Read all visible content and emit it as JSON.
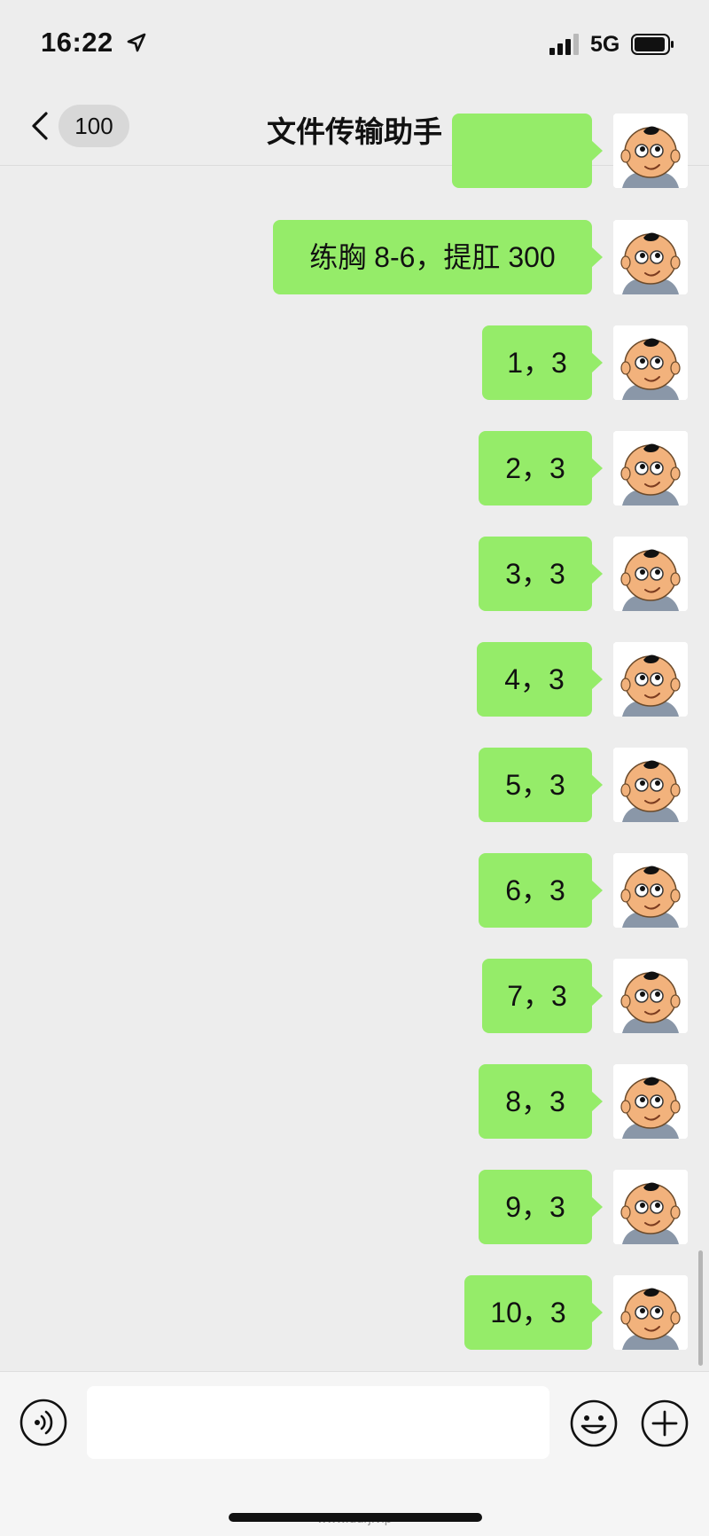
{
  "status_bar": {
    "time": "16:22",
    "network": "5G"
  },
  "nav": {
    "unread_count": "100",
    "title": "文件传输助手"
  },
  "messages": [
    {
      "text": ""
    },
    {
      "text": "练胸 8-6，提肛 300"
    },
    {
      "text": "1，3"
    },
    {
      "text": "2，3"
    },
    {
      "text": "3，3"
    },
    {
      "text": "4，3"
    },
    {
      "text": "5，3"
    },
    {
      "text": "6，3"
    },
    {
      "text": "7，3"
    },
    {
      "text": "8，3"
    },
    {
      "text": "9，3"
    },
    {
      "text": "10，3"
    }
  ],
  "input": {
    "value": "",
    "placeholder": ""
  },
  "footer": {
    "watermark": "www.ddrj.vip"
  },
  "icons": {
    "back": "chevron-left-icon",
    "more": "more-horizontal-icon",
    "voice": "voice-icon",
    "emoji": "emoji-icon",
    "plus": "plus-icon",
    "location": "location-arrow-icon",
    "signal": "signal-icon",
    "battery": "battery-icon"
  },
  "colors": {
    "bubble": "#95ec69",
    "background": "#ededed",
    "input_bar": "#f5f5f5"
  }
}
